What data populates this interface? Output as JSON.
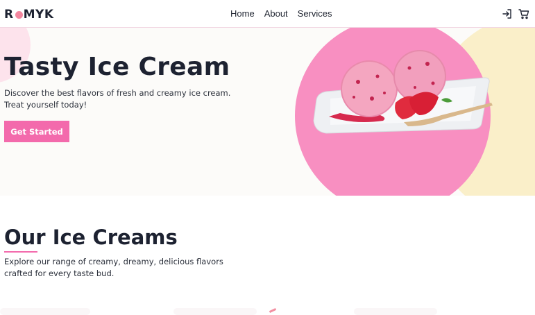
{
  "nav": {
    "logo_left": "R",
    "logo_right": "MYK",
    "links": [
      "Home",
      "About",
      "Services"
    ],
    "icons": [
      "login-icon",
      "cart-icon"
    ]
  },
  "hero": {
    "title": "Tasty Ice Cream",
    "description": "Discover the best flavors of fresh and creamy ice cream. Treat yourself today!",
    "cta": "Get Started"
  },
  "section": {
    "title": "Our Ice Creams",
    "description": "Explore our range of creamy, dreamy, delicious flavors crafted for every taste bud."
  },
  "colors": {
    "accent": "#f36aac",
    "circle_pink": "#f88fc1",
    "circle_cream": "#faefc9",
    "text": "#1d2231"
  }
}
